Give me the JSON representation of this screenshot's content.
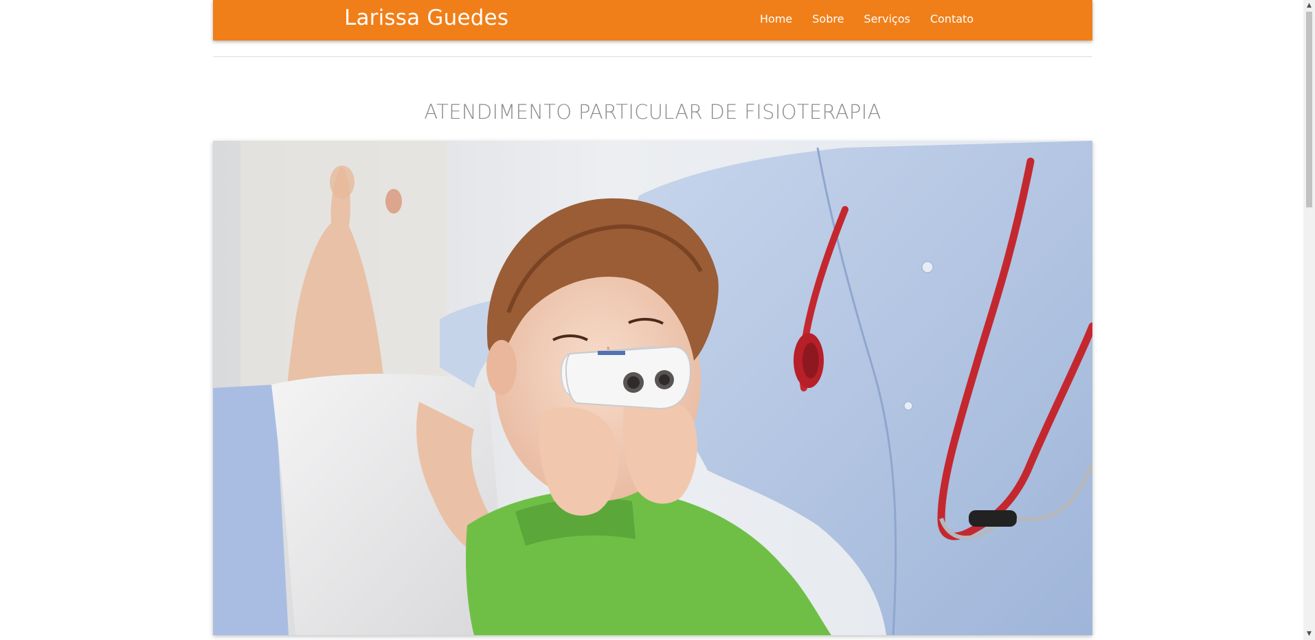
{
  "navbar": {
    "brand": "Larissa Guedes",
    "links": [
      "Home",
      "Sobre",
      "Serviços",
      "Contato"
    ],
    "background_color": "#f07f19"
  },
  "main": {
    "section_title": "ATENDIMENTO PARTICULAR DE FISIOTERAPIA",
    "hero_image": "photo-child-using-inhaler-with-doctor"
  },
  "scrollbar": {
    "up_arrow": "▲",
    "down_arrow": "▼"
  }
}
